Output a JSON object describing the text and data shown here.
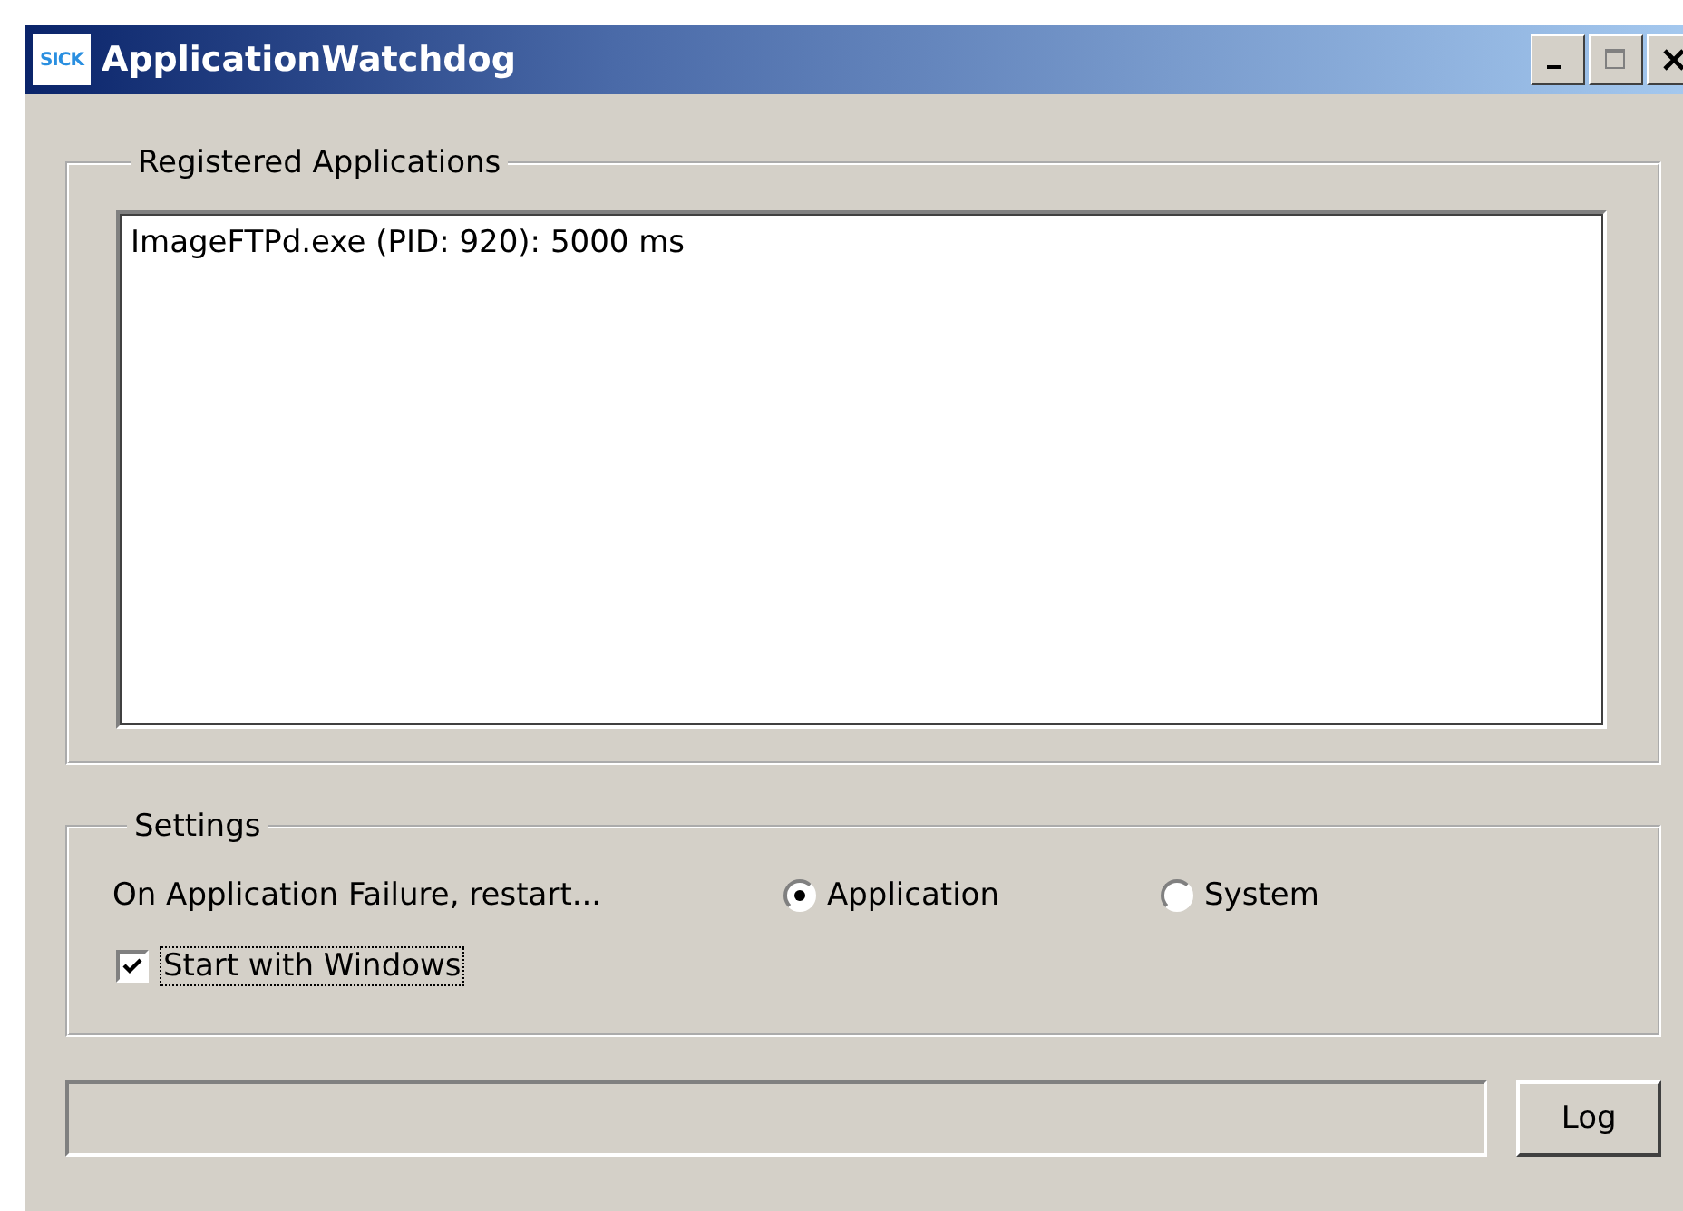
{
  "window": {
    "title": "ApplicationWatchdog",
    "logo": "SICK"
  },
  "registered_applications": {
    "title": "Registered Applications",
    "items": [
      {
        "label": "ImageFTPd.exe (PID: 920): 5000 ms"
      }
    ]
  },
  "settings": {
    "title": "Settings",
    "restart_label": "On Application Failure, restart...",
    "restart_options": [
      {
        "label": "Application",
        "selected": true
      },
      {
        "label": "System",
        "selected": false
      }
    ],
    "start_with_windows": {
      "label": "Start with Windows",
      "checked": true
    }
  },
  "log_button": "Log"
}
